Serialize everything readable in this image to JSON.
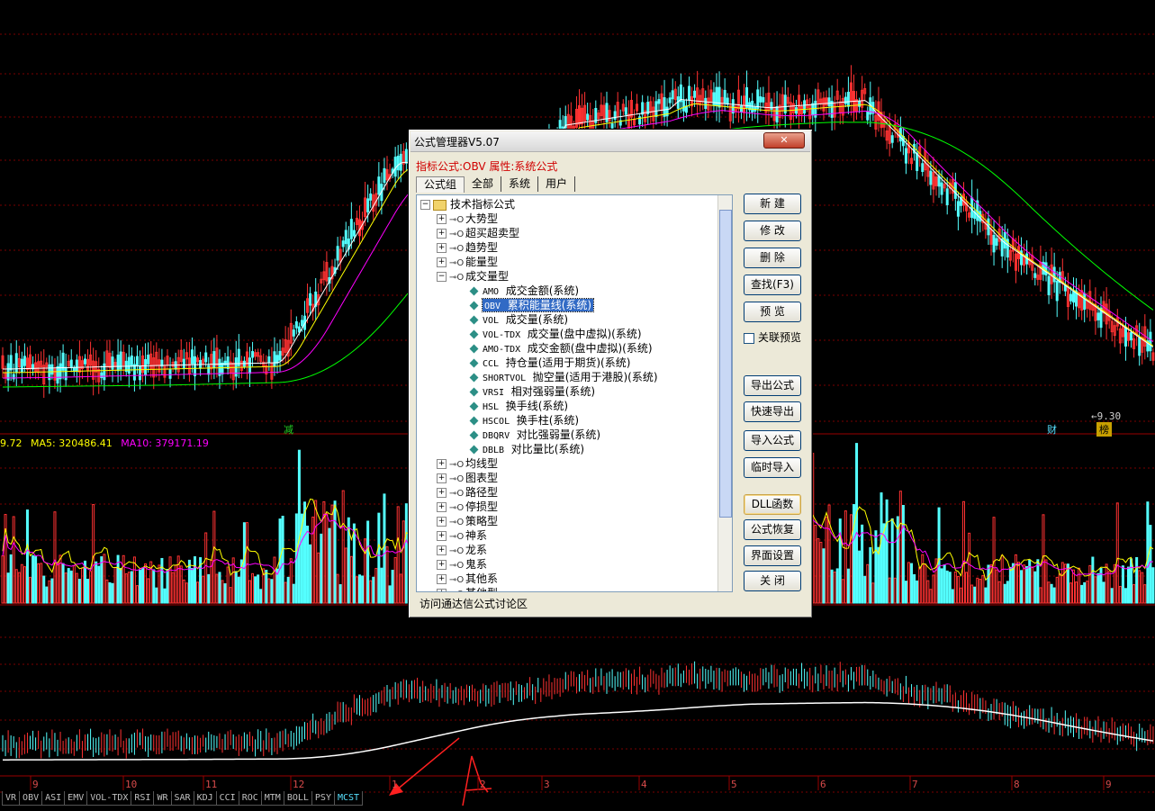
{
  "indicator_line": {
    "prefix": "9.72",
    "ma5_label": "MA5: 320486.41",
    "ma10_label": "MA10: 379171.19"
  },
  "chart_markers": {
    "low_price": "9.30",
    "cai": "财",
    "bang": "榜",
    "jian": "减"
  },
  "months": [
    "9",
    "10",
    "11",
    "12",
    "1",
    "2",
    "3",
    "4",
    "5",
    "6",
    "7",
    "8",
    "9"
  ],
  "indicator_tabs": [
    "VR",
    "OBV",
    "ASI",
    "EMV",
    "VOL-TDX",
    "RSI",
    "WR",
    "SAR",
    "KDJ",
    "CCI",
    "ROC",
    "MTM",
    "BOLL",
    "PSY",
    "MCST"
  ],
  "active_tab": "MCST",
  "colors": {
    "up": "#ff3232",
    "down": "#54ffff",
    "ma1": "#ffffff",
    "ma2": "#ffff00",
    "ma3": "#ff00ff",
    "ma4": "#00ff00",
    "grid": "#7a0000",
    "highlight": "#316ac5"
  },
  "dialog": {
    "title": "公式管理器V5.07",
    "close_label": "✕",
    "attr_line": "指标公式:OBV 属性:系统公式",
    "tabs": [
      "公式组",
      "全部",
      "系统",
      "用户"
    ],
    "tree": {
      "root": "技术指标公式",
      "groups_top": [
        "大势型",
        "超买超卖型",
        "趋势型",
        "能量型"
      ],
      "open_group": "成交量型",
      "items": [
        {
          "code": "AMO",
          "name": "成交金额(系统)"
        },
        {
          "code": "OBV",
          "name": "累积能量线(系统)",
          "selected": true
        },
        {
          "code": "VOL",
          "name": "成交量(系统)"
        },
        {
          "code": "VOL-TDX",
          "name": "成交量(盘中虚拟)(系统)"
        },
        {
          "code": "AMO-TDX",
          "name": "成交金额(盘中虚拟)(系统)"
        },
        {
          "code": "CCL",
          "name": "持仓量(适用于期货)(系统)"
        },
        {
          "code": "SHORTVOL",
          "name": "抛空量(适用于港股)(系统)"
        },
        {
          "code": "VRSI",
          "name": "相对强弱量(系统)"
        },
        {
          "code": "HSL",
          "name": "换手线(系统)"
        },
        {
          "code": "HSCOL",
          "name": "换手柱(系统)"
        },
        {
          "code": "DBQRV",
          "name": "对比强弱量(系统)"
        },
        {
          "code": "DBLB",
          "name": "对比量比(系统)"
        }
      ],
      "groups_bottom": [
        "均线型",
        "图表型",
        "路径型",
        "停损型",
        "策略型",
        "神系",
        "龙系",
        "鬼系",
        "其他系",
        "其他型"
      ]
    },
    "buttons_top": [
      "新  建",
      "修  改",
      "删  除",
      "查找(F3)",
      "预  览"
    ],
    "preview_check": "关联预览",
    "buttons_mid": [
      "导出公式",
      "快速导出",
      "导入公式",
      "临时导入"
    ],
    "buttons_bot": [
      "DLL函数",
      "公式恢复",
      "界面设置",
      "关  闭"
    ],
    "visit_text": "访问通达信公式讨论区"
  }
}
